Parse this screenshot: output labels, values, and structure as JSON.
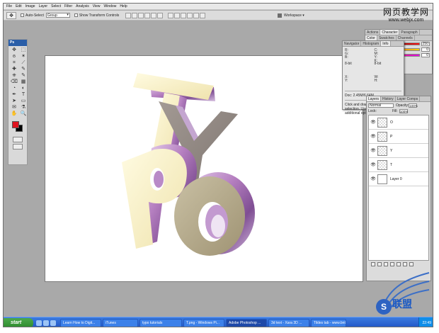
{
  "menubar": {
    "items": [
      "File",
      "Edit",
      "Image",
      "Layer",
      "Select",
      "Filter",
      "Analysis",
      "View",
      "Window",
      "Help"
    ]
  },
  "options": {
    "auto_select_label": "Auto-Select",
    "auto_select_target": "Group",
    "show_transform_label": "Show Transform Controls",
    "workspace_label": "Workspace ▾"
  },
  "toolbox": {
    "title": "Ps",
    "icons": [
      "move-icon",
      "marquee-icon",
      "lasso-icon",
      "magic-wand-icon",
      "crop-icon",
      "slice-icon",
      "heal-icon",
      "brush-icon",
      "stamp-icon",
      "history-brush-icon",
      "eraser-icon",
      "gradient-icon",
      "blur-icon",
      "dodge-icon",
      "pen-icon",
      "type-icon",
      "path-select-icon",
      "shape-icon",
      "notes-icon",
      "eyedropper-icon",
      "hand-icon",
      "zoom-icon"
    ],
    "glyphs": [
      "✥",
      "⬚",
      "ϭ",
      "✶",
      "⌗",
      "⟋",
      "✚",
      "✎",
      "⎈",
      "✎",
      "⌫",
      "▦",
      "◔",
      "◐",
      "✒",
      "T",
      "➤",
      "▭",
      "✉",
      "⚗",
      "✋",
      "🔍"
    ],
    "foreground_color": "#e0131f",
    "background_color": "#000000"
  },
  "dock_top": {
    "tabs": [
      "Actions",
      "Character",
      "Paragraph",
      "Swatches"
    ],
    "color_tabs": [
      "Color",
      "Swatches",
      "Styles",
      "Channels"
    ],
    "values": [
      "250",
      "0",
      "0"
    ]
  },
  "navpanel": {
    "tabs": [
      "Navigator",
      "Histogram",
      "Info"
    ],
    "rgb": "R:\nG:\nB:",
    "cmyk": "C:\nM:\nY:\nK:",
    "bits_left": "8-bit",
    "bits_right": "8-bit",
    "xy": "X:\nY:",
    "wh": "W:\nH:",
    "doc": "Doc: 2.45M/6.64M",
    "hint": "Click and drag to move layer or selection. Use Shift, Alt, and Ctrl for additional options."
  },
  "layers": {
    "tabs": [
      "Layers",
      "History",
      "Layer Comps"
    ],
    "blend_mode": "Normal",
    "opacity_label": "Opacity:",
    "opacity_value": "100%",
    "lock_label": "Lock:",
    "fill_label": "Fill:",
    "fill_value": "100%",
    "items": [
      {
        "name": "O"
      },
      {
        "name": "P"
      },
      {
        "name": "Y"
      },
      {
        "name": "T"
      },
      {
        "name": "Layer 0"
      }
    ]
  },
  "taskbar": {
    "start": "start",
    "tasks": [
      "Learn How to Digit...",
      "iTunes",
      "typo tutorials",
      "T.png - Windows Pi...",
      "Adobe Photoshop ...",
      "3d text - Xara 3D ...",
      "Tildes tab - www.bnt..."
    ],
    "clock": "22:49"
  },
  "watermark": {
    "site_cn": "网页教学网",
    "site_en": "www.webjx.com",
    "logo_text": "联盟"
  },
  "colors": {
    "canvas_bg": "#ffffff",
    "workspace_bg": "#a9a9a9",
    "letter_cream": "#f7f0c2",
    "letter_side_purple": "#b57fc0",
    "letter_khaki": "#b9ad8e"
  }
}
